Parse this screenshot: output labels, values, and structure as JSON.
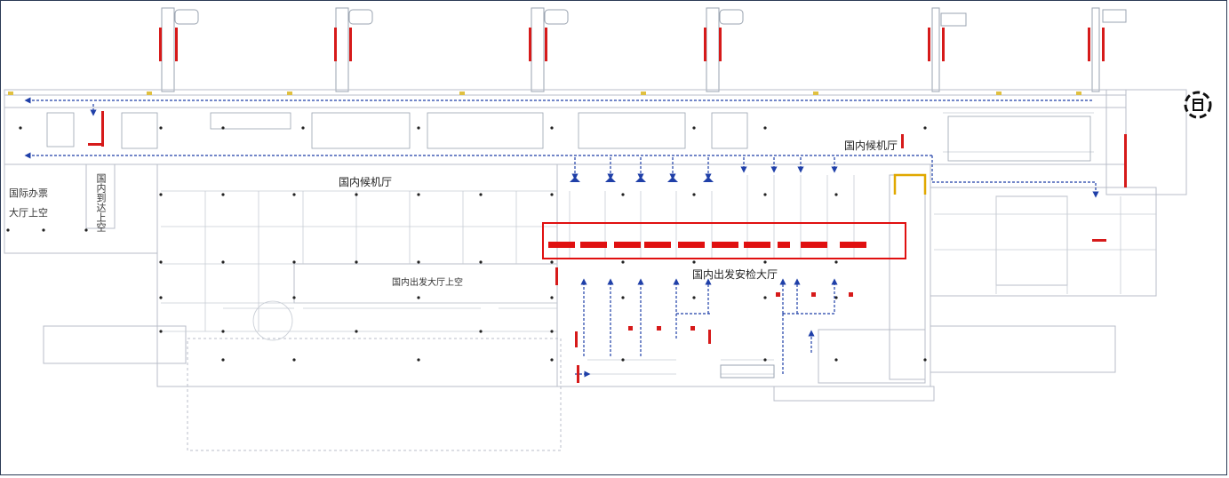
{
  "labels": {
    "intl_ticket_hall_void": "国际办票大厅上空",
    "domestic_arrival_void": "国内到达上空",
    "domestic_waiting_hall_west": "国内候机厅",
    "domestic_waiting_hall_east": "国内候机厅",
    "domestic_departure_hall_void": "国内出发大厅上空",
    "domestic_security_hall": "国内出发安检大厅"
  },
  "compass_icon": "compass-icon",
  "colors": {
    "walls": "#b8bec8",
    "structure": "#222222",
    "flow_arrows": "#1f3fa8",
    "red_markers": "#d61a1a",
    "highlight_box": "#e01010",
    "gold_marker": "#e0a800"
  }
}
